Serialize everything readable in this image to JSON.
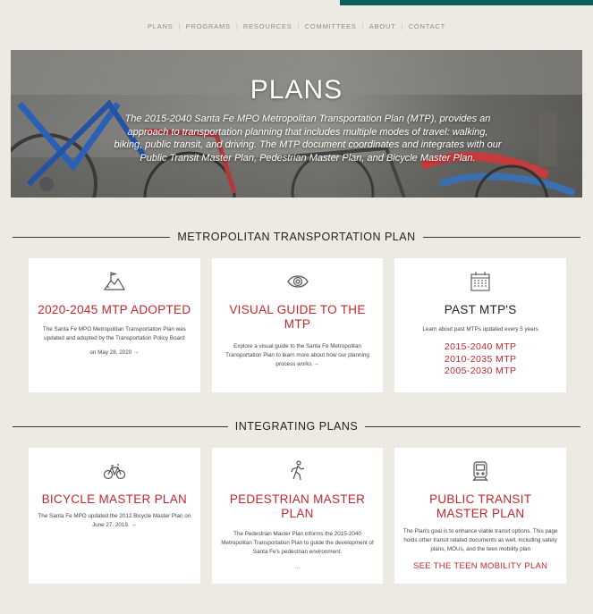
{
  "nav": {
    "items": [
      "PLANS",
      "PROGRAMS",
      "RESOURCES",
      "COMMITTEES",
      "ABOUT",
      "CONTACT"
    ]
  },
  "hero": {
    "title": "PLANS",
    "text": "The 2015-2040 Santa Fe MPO Metropolitan Transportation Plan (MTP), provides an approach to transportation planning that includes multiple modes of travel: walking, biking, public transit, and driving. The MTP document coordinates and integrates with our Public Transit Master Plan, Pedestrian Master Plan, and Bicycle Master Plan."
  },
  "section1": {
    "heading": "METROPOLITAN TRANSPORTATION PLAN",
    "cards": [
      {
        "icon": "mountain-flag-icon",
        "title": "2020-2045 MTP ADOPTED",
        "text": "The Santa Fe MPO Metropolitan Transportation Plan was updated and adopted by the Transportation Policy Board",
        "more": "on May 28, 2020 →"
      },
      {
        "icon": "eye-icon",
        "title": "VISUAL GUIDE TO THE MTP",
        "text": "Explore a visual guide to the Santa Fe Metropolitan Transportation Plan to learn more about how our planning process works →"
      },
      {
        "icon": "calendar-icon",
        "title": "PAST MTP'S",
        "text": "Learn about past MTPs updated every 5 years",
        "links": [
          "2015-2040 MTP",
          "2010-2035 MTP",
          "2005-2030 MTP"
        ]
      }
    ]
  },
  "section2": {
    "heading": "INTEGRATING PLANS",
    "cards": [
      {
        "icon": "bicycle-icon",
        "title": "BICYCLE MASTER PLAN",
        "text": "The Santa Fe MPO updated the 2012 Bicycle Master Plan on June 27, 2019. →"
      },
      {
        "icon": "pedestrian-icon",
        "title": "PEDESTRIAN MASTER PLAN",
        "text": "The Pedestrian Master Plan informs the 2015-2040 Metropolitan Transportation Plan to guide the development of Santa Fe's pedestrian environment.",
        "more": "..."
      },
      {
        "icon": "train-icon",
        "title": "PUBLIC TRANSIT MASTER PLAN",
        "text": "The Plan's goal is to enhance viable transit options. This page holds other transit related documents as well, including safety plans, MOUs, and the teen mobility plan",
        "cta": "SEE THE TEEN MOBILITY PLAN"
      }
    ]
  },
  "colors": {
    "accent": "#c2272d",
    "top_bar": "#0d5e59",
    "background": "#edeae4"
  }
}
